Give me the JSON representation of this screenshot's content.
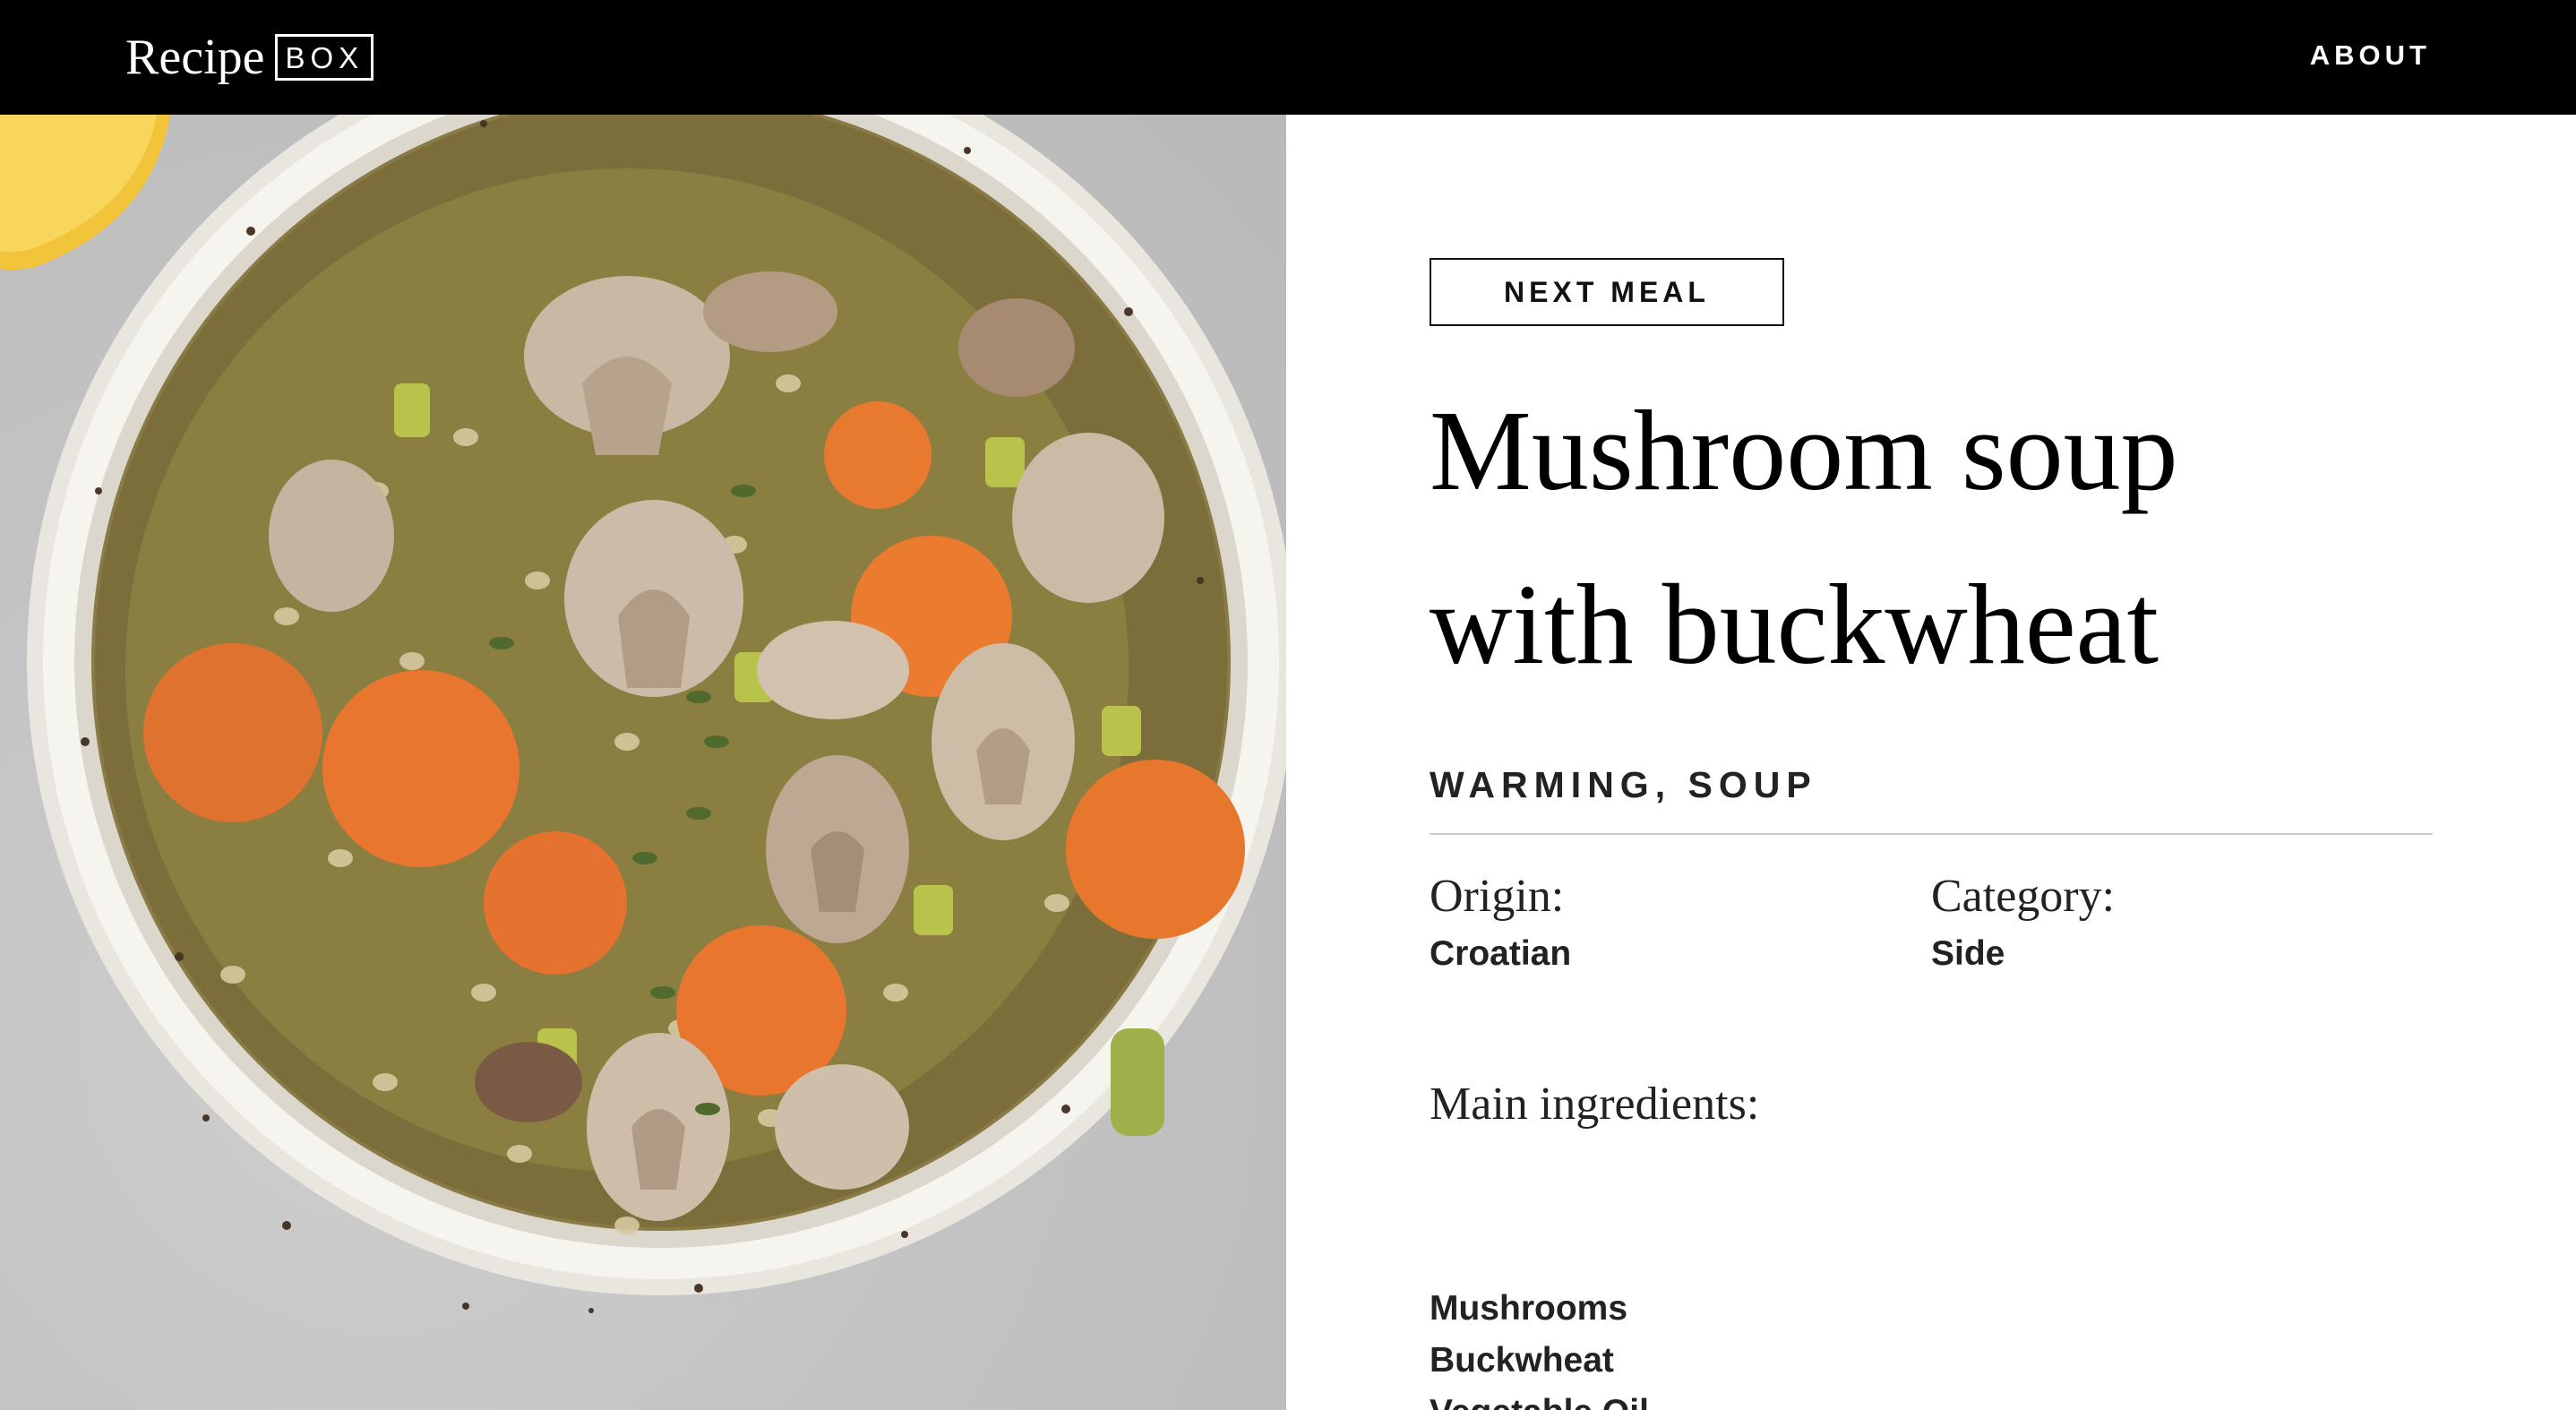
{
  "header": {
    "logo_word": "Recipe",
    "logo_box": "BOX",
    "nav_about": "ABOUT"
  },
  "photo": {
    "icon": "soup-bowl-photo"
  },
  "recipe": {
    "next_button": "NEXT MEAL",
    "title_line1": "Mushroom soup",
    "title_line2": "with buckwheat",
    "tags": "WARMING, SOUP",
    "origin_label": "Origin:",
    "origin_value": "Croatian",
    "category_label": "Category:",
    "category_value": "Side",
    "ingredients_label": "Main ingredients:",
    "ingredients": [
      "Mushrooms",
      "Buckwheat",
      "Vegetable Oil"
    ]
  },
  "colors": {
    "header_bg": "#000000",
    "header_text": "#ffffff",
    "text": "#222222",
    "divider": "#cccccc"
  }
}
